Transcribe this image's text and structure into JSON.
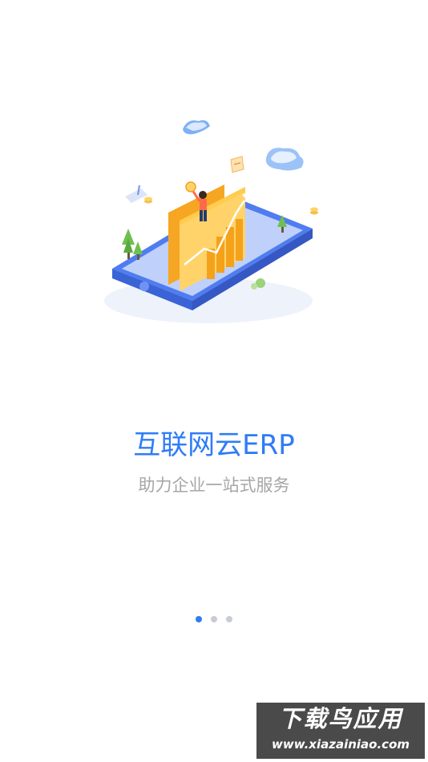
{
  "onboarding": {
    "title": "互联网云ERP",
    "subtitle": "助力企业一站式服务",
    "page_indicator": {
      "count": 3,
      "active_index": 0
    },
    "illustration": "phone-growth-chart-illustration"
  },
  "watermark": {
    "top": "下载鸟应用",
    "bottom": "www.xiazainiao.com"
  },
  "colors": {
    "accent": "#2f7cf6",
    "subtitle": "#a6a6a6",
    "dot_inactive": "#c8ccd6"
  }
}
